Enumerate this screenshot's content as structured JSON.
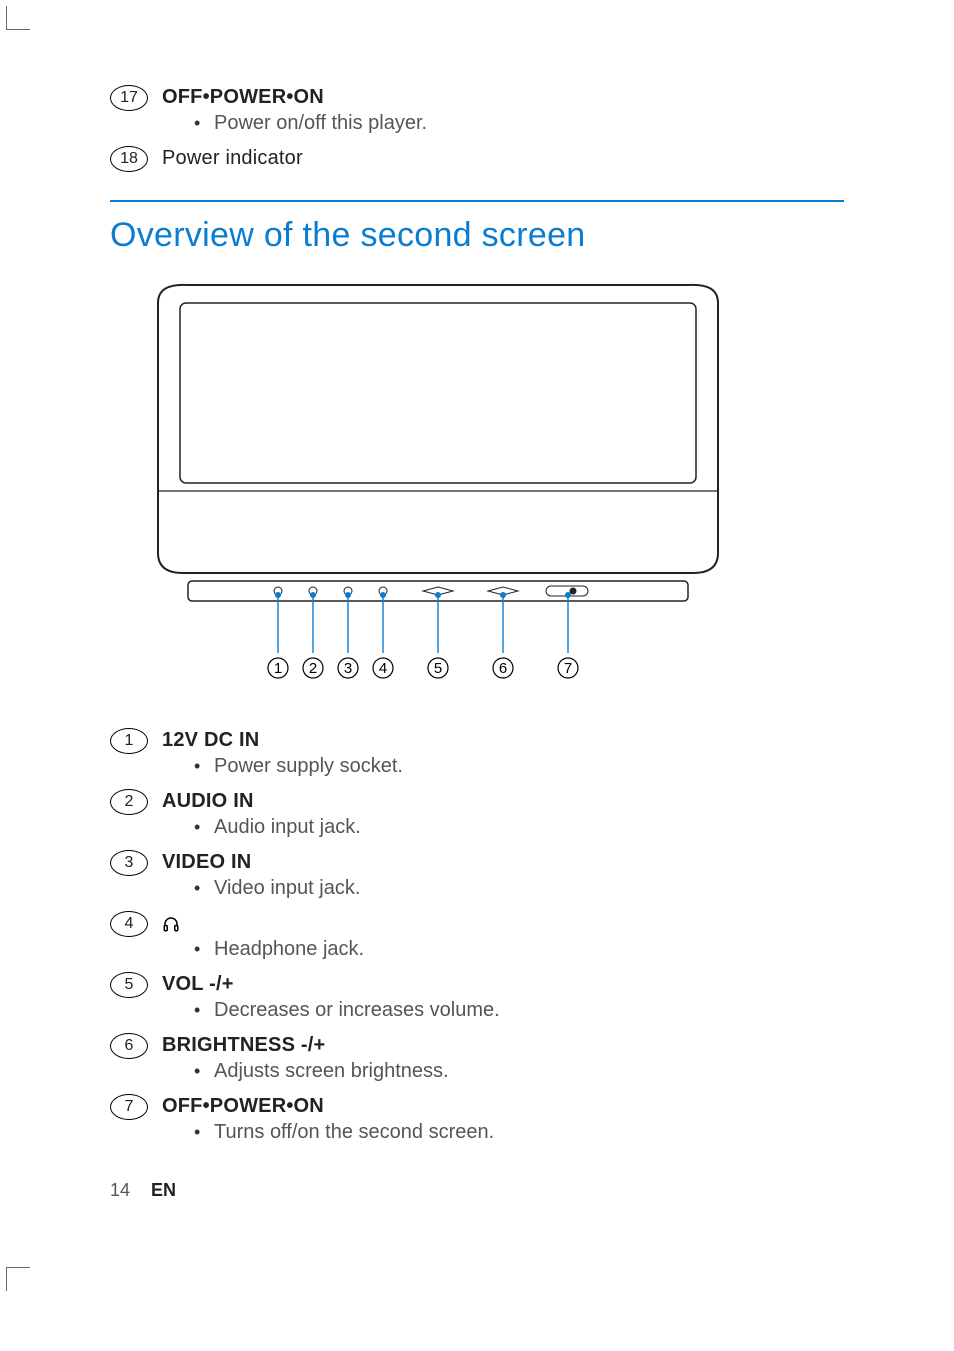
{
  "top_items": [
    {
      "num": "17",
      "title": "OFF•POWER•ON",
      "desc": "Power on/off this player."
    },
    {
      "num": "18",
      "title": "Power indicator",
      "desc": null
    }
  ],
  "section_title": "Overview of the second screen",
  "callouts": [
    "1",
    "2",
    "3",
    "4",
    "5",
    "6",
    "7"
  ],
  "items": [
    {
      "num": "1",
      "title": "12V DC IN",
      "desc": "Power supply socket."
    },
    {
      "num": "2",
      "title": "AUDIO IN",
      "desc": "Audio input jack."
    },
    {
      "num": "3",
      "title": "VIDEO IN",
      "desc": "Video input jack."
    },
    {
      "num": "4",
      "title": null,
      "icon": "headphones",
      "desc": "Headphone jack."
    },
    {
      "num": "5",
      "title": "VOL -/+",
      "desc": "Decreases or increases volume."
    },
    {
      "num": "6",
      "title": "BRIGHTNESS -/+",
      "desc": "Adjusts screen brightness."
    },
    {
      "num": "7",
      "title": "OFF•POWER•ON",
      "desc": "Turns off/on the second screen."
    }
  ],
  "footer": {
    "page": "14",
    "lang": "EN"
  }
}
